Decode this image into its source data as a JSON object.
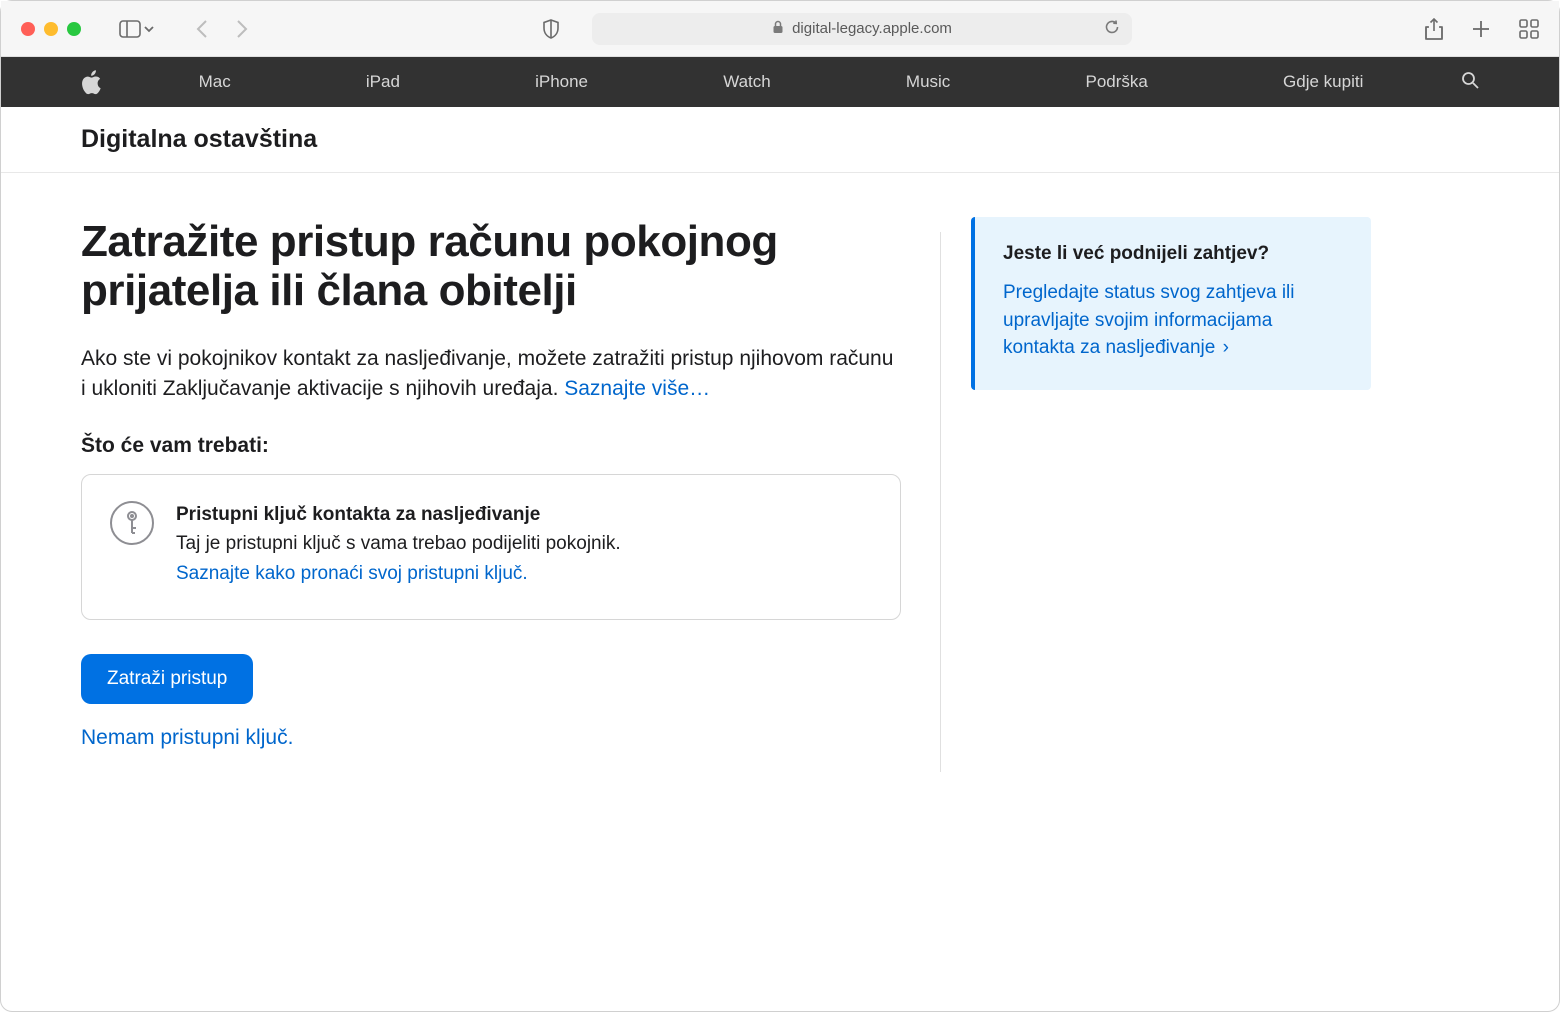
{
  "browser": {
    "url": "digital-legacy.apple.com"
  },
  "globalNav": {
    "items": [
      "Mac",
      "iPad",
      "iPhone",
      "Watch",
      "Music",
      "Podrška",
      "Gdje kupiti"
    ]
  },
  "localNav": {
    "title": "Digitalna ostavština"
  },
  "main": {
    "heading": "Zatražite pristup računu pokojnog prijatelja ili člana obitelji",
    "description": "Ako ste vi pokojnikov kontakt za nasljeđivanje, možete zatražiti pristup njihovom računu i ukloniti Zaključavanje aktivacije s njihovih uređaja. ",
    "descriptionLink": "Saznajte više…",
    "subHeading": "Što će vam trebati:",
    "card": {
      "title": "Pristupni ključ kontakta za nasljeđivanje",
      "text": "Taj je pristupni ključ s vama trebao podijeliti pokojnik.",
      "link": "Saznajte kako pronaći svoj pristupni ključ."
    },
    "primaryButton": "Zatraži pristup",
    "secondaryLink": "Nemam pristupni ključ."
  },
  "aside": {
    "title": "Jeste li već podnijeli zahtjev?",
    "link": "Pregledajte status svog zahtjeva ili upravljajte svojim informacijama kontakta za nasljeđivanje"
  }
}
